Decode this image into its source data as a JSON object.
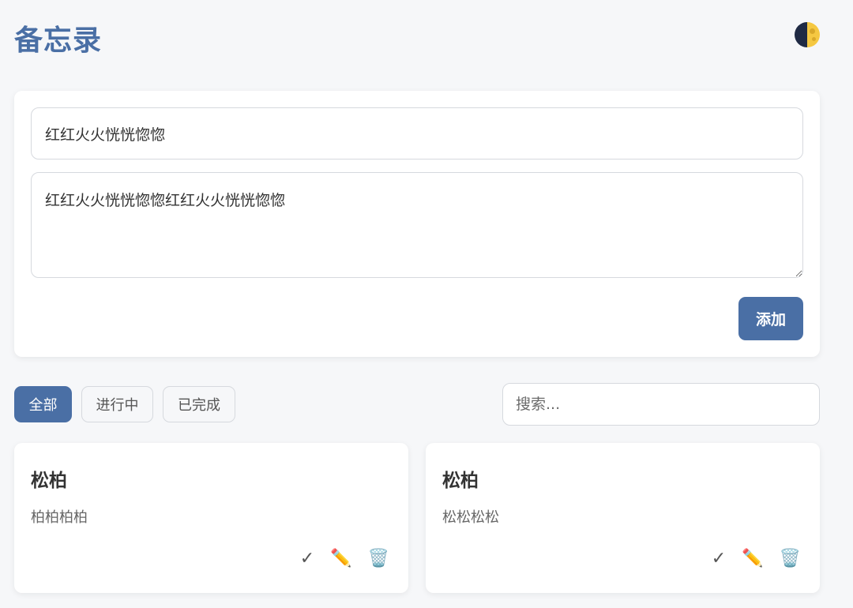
{
  "header": {
    "title": "备忘录",
    "theme_toggle_icon": "moon-icon"
  },
  "form": {
    "title_value": "红红火火恍恍惚惚",
    "title_placeholder": "",
    "content_value": "红红火火恍恍惚惚红红火火恍恍惚惚",
    "add_label": "添加"
  },
  "filters": {
    "all": "全部",
    "active": "进行中",
    "done": "已完成",
    "selected": "全部"
  },
  "search": {
    "placeholder": "搜索..."
  },
  "notes": [
    {
      "title": "松柏",
      "content": "柏柏柏柏"
    },
    {
      "title": "松柏",
      "content": "松松松松"
    }
  ],
  "actions": {
    "complete_glyph": "✓",
    "edit_glyph": "✏️",
    "delete_glyph": "🗑️"
  },
  "colors": {
    "accent": "#4a6fa5",
    "background": "#f6f7f9",
    "card": "#ffffff"
  }
}
